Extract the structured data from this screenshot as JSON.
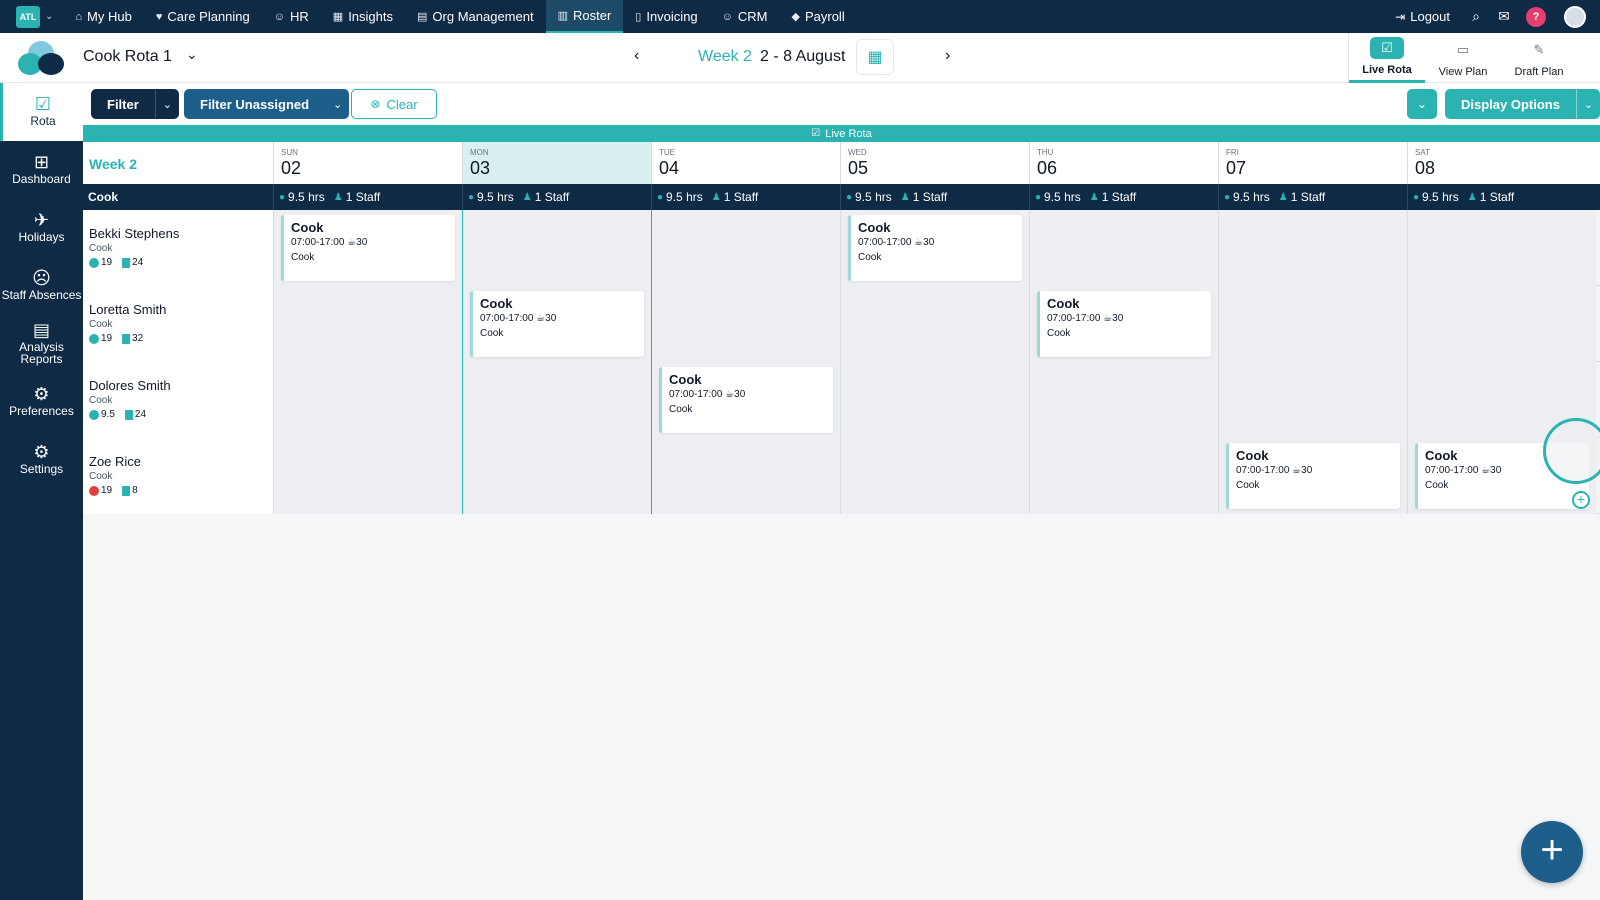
{
  "brand": {
    "label": "ATL"
  },
  "topnav": {
    "items": [
      {
        "label": "My Hub",
        "icon": "⌂"
      },
      {
        "label": "Care Planning",
        "icon": "♥"
      },
      {
        "label": "HR",
        "icon": "☺"
      },
      {
        "label": "Insights",
        "icon": "▦"
      },
      {
        "label": "Org Management",
        "icon": "▤"
      },
      {
        "label": "Roster",
        "icon": "▥",
        "active": true
      },
      {
        "label": "Invoicing",
        "icon": "▯"
      },
      {
        "label": "CRM",
        "icon": "☺"
      },
      {
        "label": "Payroll",
        "icon": "◆"
      }
    ],
    "logout": "Logout",
    "help": "?"
  },
  "header": {
    "rota_title": "Cook Rota 1",
    "week_label": "Week 2",
    "week_range": "2 - 8 August",
    "view_tabs": [
      {
        "label": "Live Rota",
        "active": true
      },
      {
        "label": "View Plan"
      },
      {
        "label": "Draft Plan"
      }
    ]
  },
  "sidebar": {
    "items": [
      {
        "label": "Rota",
        "icon": "☑",
        "active": true
      },
      {
        "label": "Dashboard",
        "icon": "⊞"
      },
      {
        "label": "Holidays",
        "icon": "✈"
      },
      {
        "label": "Staff Absences",
        "icon": "☹"
      },
      {
        "label": "Analysis Reports",
        "icon": "▤"
      },
      {
        "label": "Preferences",
        "icon": "⚙"
      },
      {
        "label": "Settings",
        "icon": "⚙"
      }
    ]
  },
  "filters": {
    "filter_label": "Filter",
    "filter_unassigned_label": "Filter Unassigned",
    "clear_label": "Clear",
    "display_options_label": "Display Options"
  },
  "live_strip": {
    "label": "Live Rota"
  },
  "grid": {
    "week_label": "Week 2",
    "role_label": "Cook",
    "days": [
      {
        "dow": "SUN",
        "num": "02",
        "hours": "9.5 hrs",
        "staff": "1 Staff"
      },
      {
        "dow": "MON",
        "num": "03",
        "hours": "9.5 hrs",
        "staff": "1 Staff",
        "today": true
      },
      {
        "dow": "TUE",
        "num": "04",
        "hours": "9.5 hrs",
        "staff": "1 Staff"
      },
      {
        "dow": "WED",
        "num": "05",
        "hours": "9.5 hrs",
        "staff": "1 Staff"
      },
      {
        "dow": "THU",
        "num": "06",
        "hours": "9.5 hrs",
        "staff": "1 Staff"
      },
      {
        "dow": "FRI",
        "num": "07",
        "hours": "9.5 hrs",
        "staff": "1 Staff"
      },
      {
        "dow": "SAT",
        "num": "08",
        "hours": "9.5 hrs",
        "staff": "1 Staff"
      }
    ],
    "staff": [
      {
        "name": "Bekki Stephens",
        "role": "Cook",
        "hours": "19",
        "count": "24",
        "alert": false,
        "shifts": [
          0,
          3
        ]
      },
      {
        "name": "Loretta Smith",
        "role": "Cook",
        "hours": "19",
        "count": "32",
        "alert": false,
        "shifts": [
          1,
          4
        ]
      },
      {
        "name": "Dolores Smith",
        "role": "Cook",
        "hours": "9.5",
        "count": "24",
        "alert": false,
        "shifts": [
          2
        ]
      },
      {
        "name": "Zoe Rice",
        "role": "Cook",
        "hours": "19",
        "count": "8",
        "alert": true,
        "shifts": [
          5,
          6
        ]
      }
    ],
    "shift": {
      "title": "Cook",
      "time": "07:00-17:00",
      "break": "30",
      "role": "Cook"
    }
  },
  "colors": {
    "accent": "#2bb3b1",
    "navy": "#0f2a45",
    "alert": "#e43f3f"
  }
}
